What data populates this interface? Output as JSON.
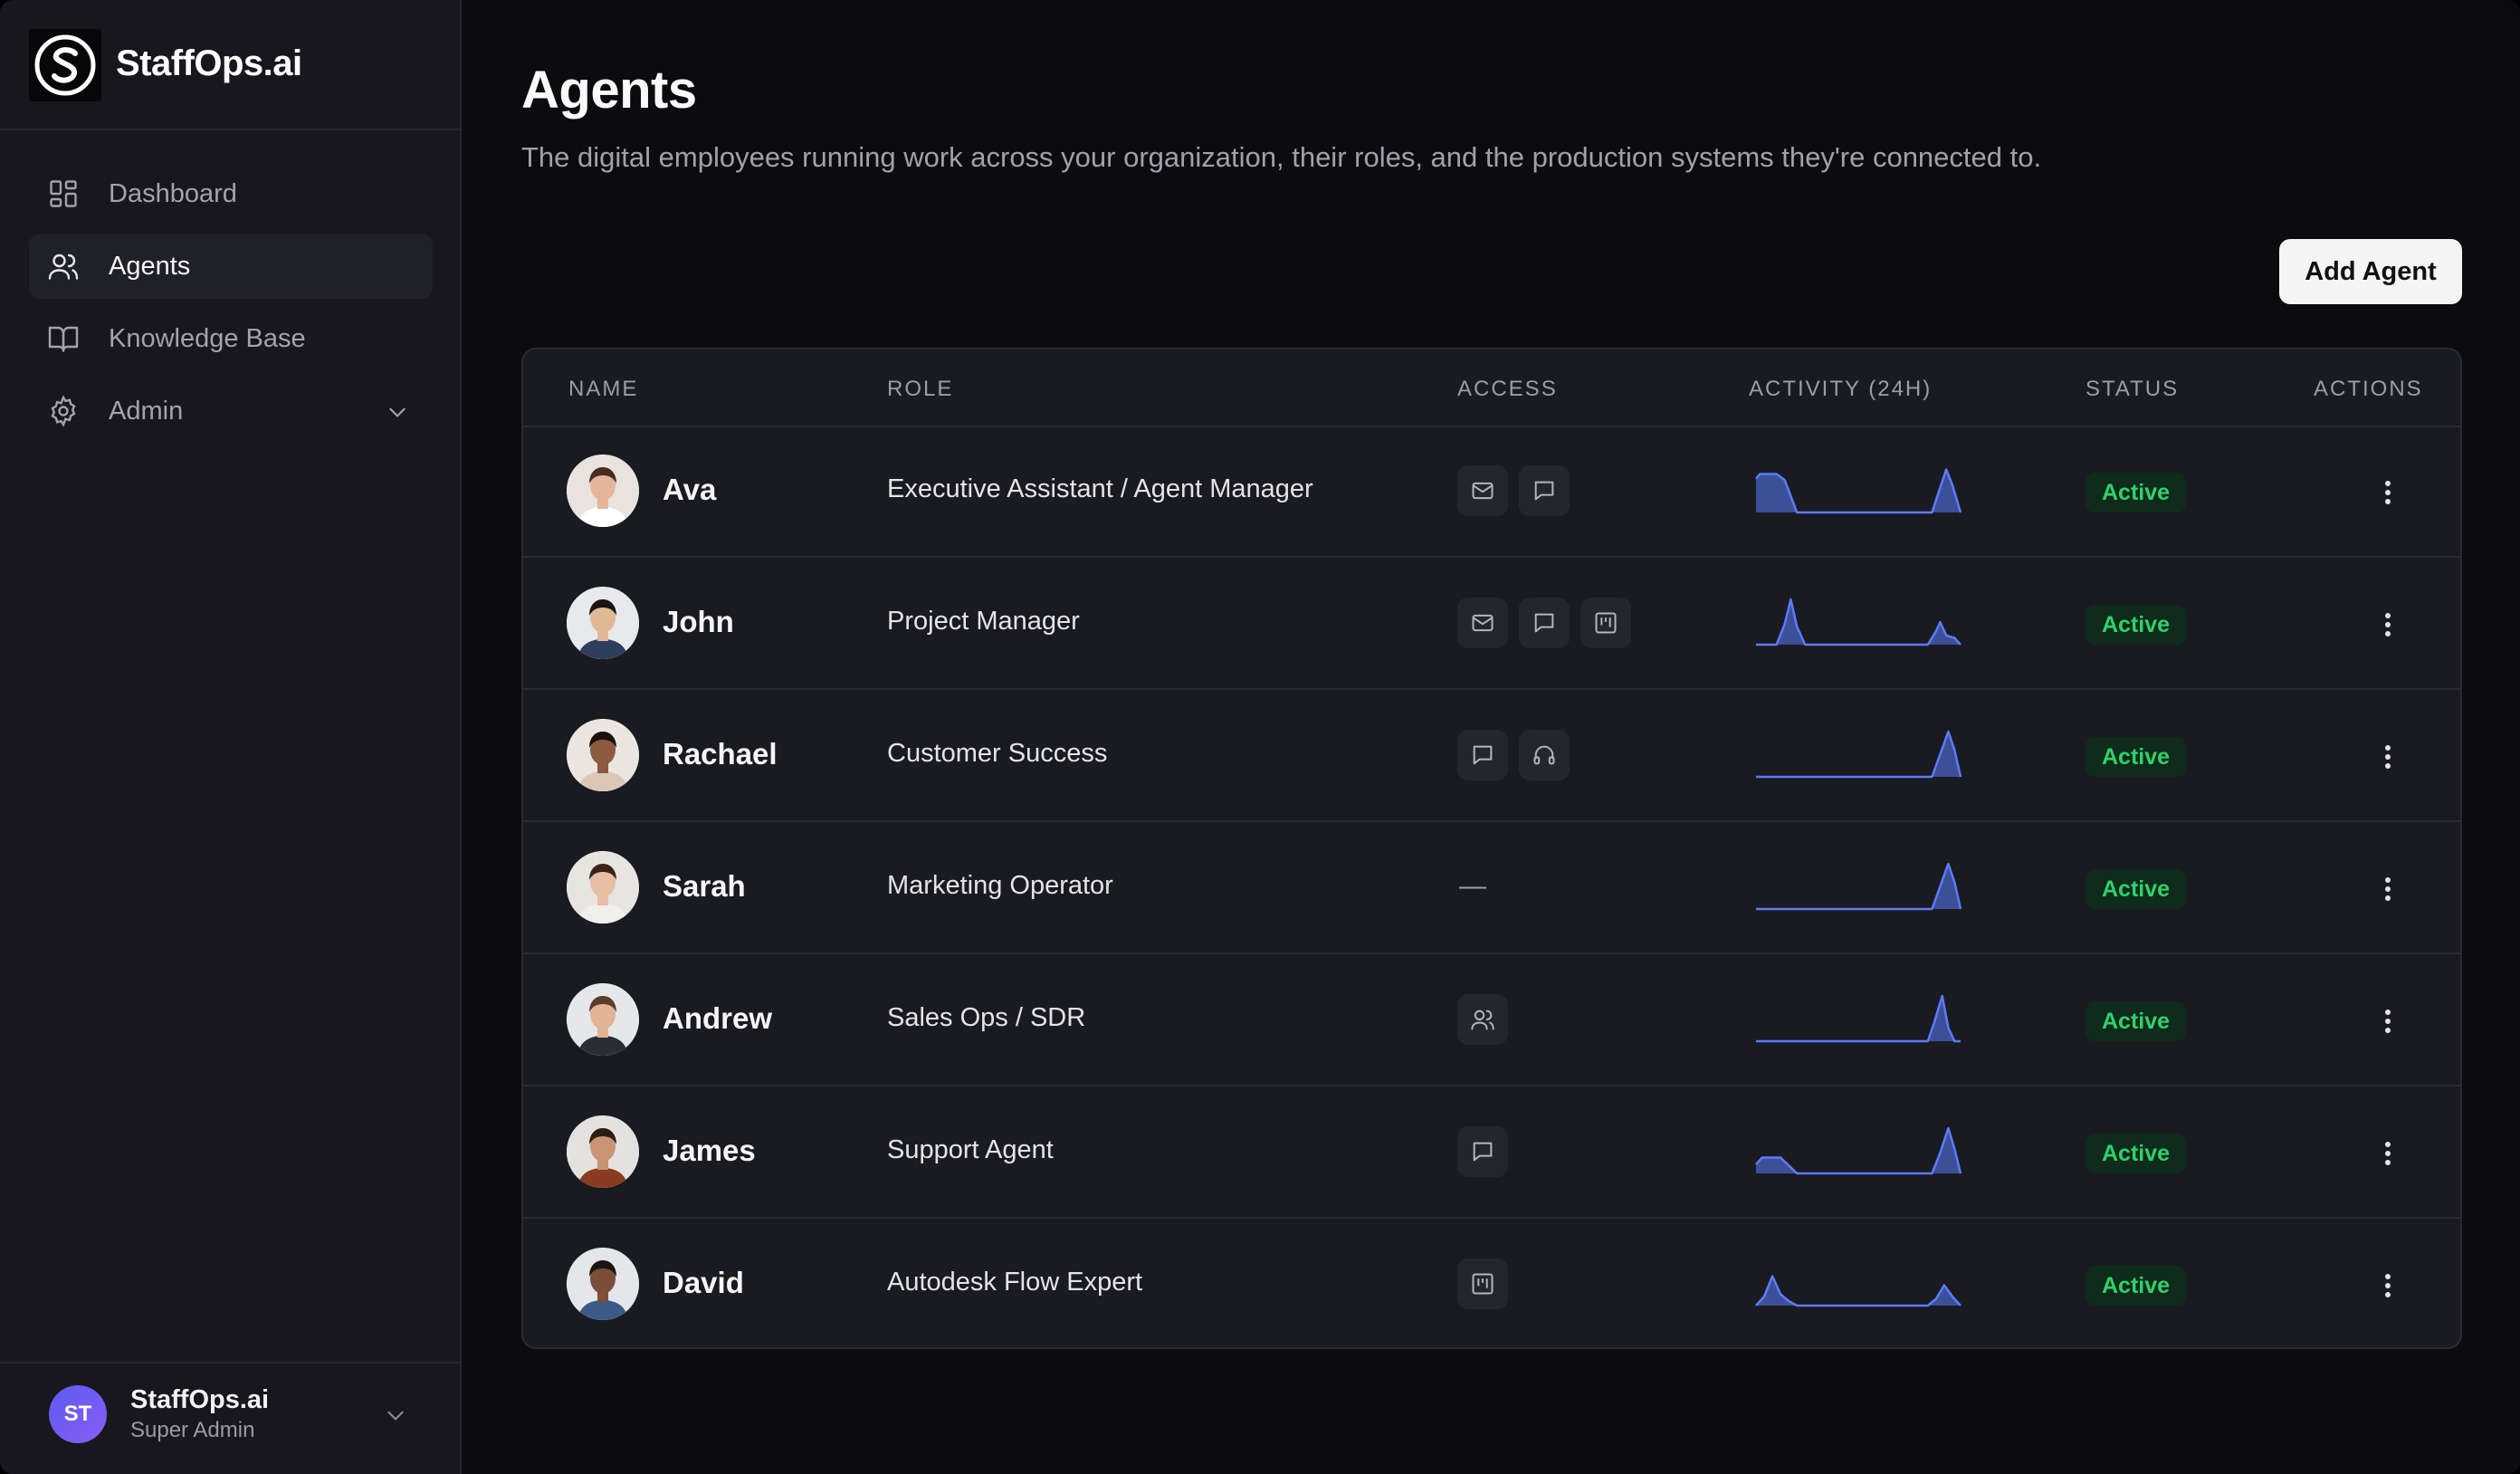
{
  "app": {
    "brand_name": "StaffOps.ai",
    "accent_color": "#5b7cfa",
    "status_color": "#2fd16b"
  },
  "sidebar": {
    "items": [
      {
        "label": "Dashboard",
        "icon": "dashboard-icon"
      },
      {
        "label": "Agents",
        "icon": "users-icon",
        "active": true
      },
      {
        "label": "Knowledge Base",
        "icon": "book-icon"
      },
      {
        "label": "Admin",
        "icon": "gear-icon",
        "expandable": true
      }
    ],
    "user": {
      "initials": "ST",
      "name": "StaffOps.ai",
      "role": "Super Admin"
    }
  },
  "main": {
    "title": "Agents",
    "subtitle": "The digital employees running work across your organization, their roles, and the production systems they're connected to.",
    "add_button_label": "Add Agent"
  },
  "table": {
    "columns": [
      "NAME",
      "ROLE",
      "ACCESS",
      "ACTIVITY (24H)",
      "STATUS",
      "ACTIONS"
    ],
    "rows": [
      {
        "name": "Ava",
        "role": "Executive Assistant / Agent Manager",
        "access": [
          "mail-icon",
          "chat-icon"
        ],
        "access_empty": "",
        "status": "Active"
      },
      {
        "name": "John",
        "role": "Project Manager",
        "access": [
          "mail-icon",
          "chat-icon",
          "kanban-icon"
        ],
        "access_empty": "",
        "status": "Active"
      },
      {
        "name": "Rachael",
        "role": "Customer Success",
        "access": [
          "chat-icon",
          "headset-icon"
        ],
        "access_empty": "",
        "status": "Active"
      },
      {
        "name": "Sarah",
        "role": "Marketing Operator",
        "access": [],
        "access_empty": "—",
        "status": "Active"
      },
      {
        "name": "Andrew",
        "role": "Sales Ops / SDR",
        "access": [
          "users-icon"
        ],
        "access_empty": "",
        "status": "Active"
      },
      {
        "name": "James",
        "role": "Support Agent",
        "access": [
          "chat-icon"
        ],
        "access_empty": "",
        "status": "Active"
      },
      {
        "name": "David",
        "role": "Autodesk Flow Expert",
        "access": [
          "kanban-icon"
        ],
        "access_empty": "",
        "status": "Active"
      }
    ]
  }
}
